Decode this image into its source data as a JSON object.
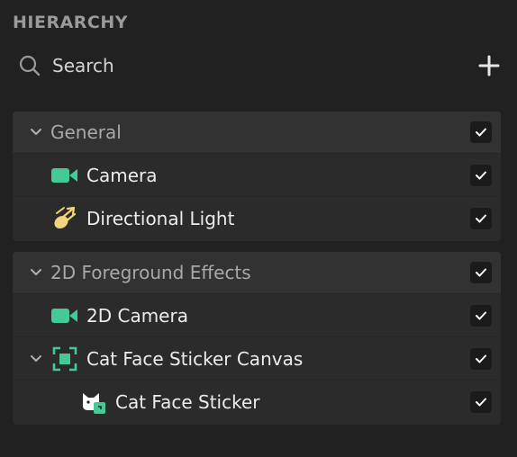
{
  "panel": {
    "title": "HIERARCHY"
  },
  "search": {
    "label": "Search"
  },
  "groups": [
    {
      "header": "General",
      "items": [
        {
          "label": "Camera",
          "icon": "camera-icon",
          "checked": true
        },
        {
          "label": "Directional Light",
          "icon": "directional-light-icon",
          "checked": true
        }
      ],
      "checked": true
    },
    {
      "header": "2D Foreground Effects",
      "items": [
        {
          "label": "2D Camera",
          "icon": "camera-icon",
          "checked": true
        },
        {
          "label": "Cat Face Sticker Canvas",
          "icon": "canvas-icon",
          "checked": true,
          "expanded": true
        },
        {
          "label": "Cat Face Sticker",
          "icon": "sticker-icon",
          "checked": true
        }
      ],
      "checked": true
    }
  ],
  "colors": {
    "background": "#212121",
    "group_bg": "#2b2b2b",
    "header_bg": "#323232",
    "accent_green": "#45c997",
    "light_yellow": "#f2d47a"
  }
}
